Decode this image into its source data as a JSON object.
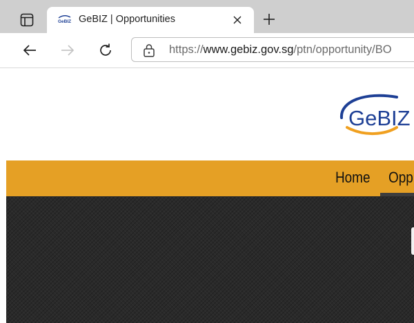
{
  "browser": {
    "tab": {
      "title": "GeBIZ | Opportunities",
      "favicon_text": "GeBIZ"
    },
    "address": {
      "scheme": "https://",
      "host": "www.gebiz.gov.sg",
      "path": "/ptn/opportunity/BO"
    }
  },
  "page": {
    "logo": {
      "text_ge": "Ge",
      "text_biz": "BIZ"
    },
    "nav": {
      "home": "Home",
      "opportunities": "Opp"
    },
    "colors": {
      "navbar": "#e5a025",
      "hero": "#2a2a2a",
      "logo_blue": "#1d3f95",
      "logo_orange": "#f0a020"
    }
  }
}
